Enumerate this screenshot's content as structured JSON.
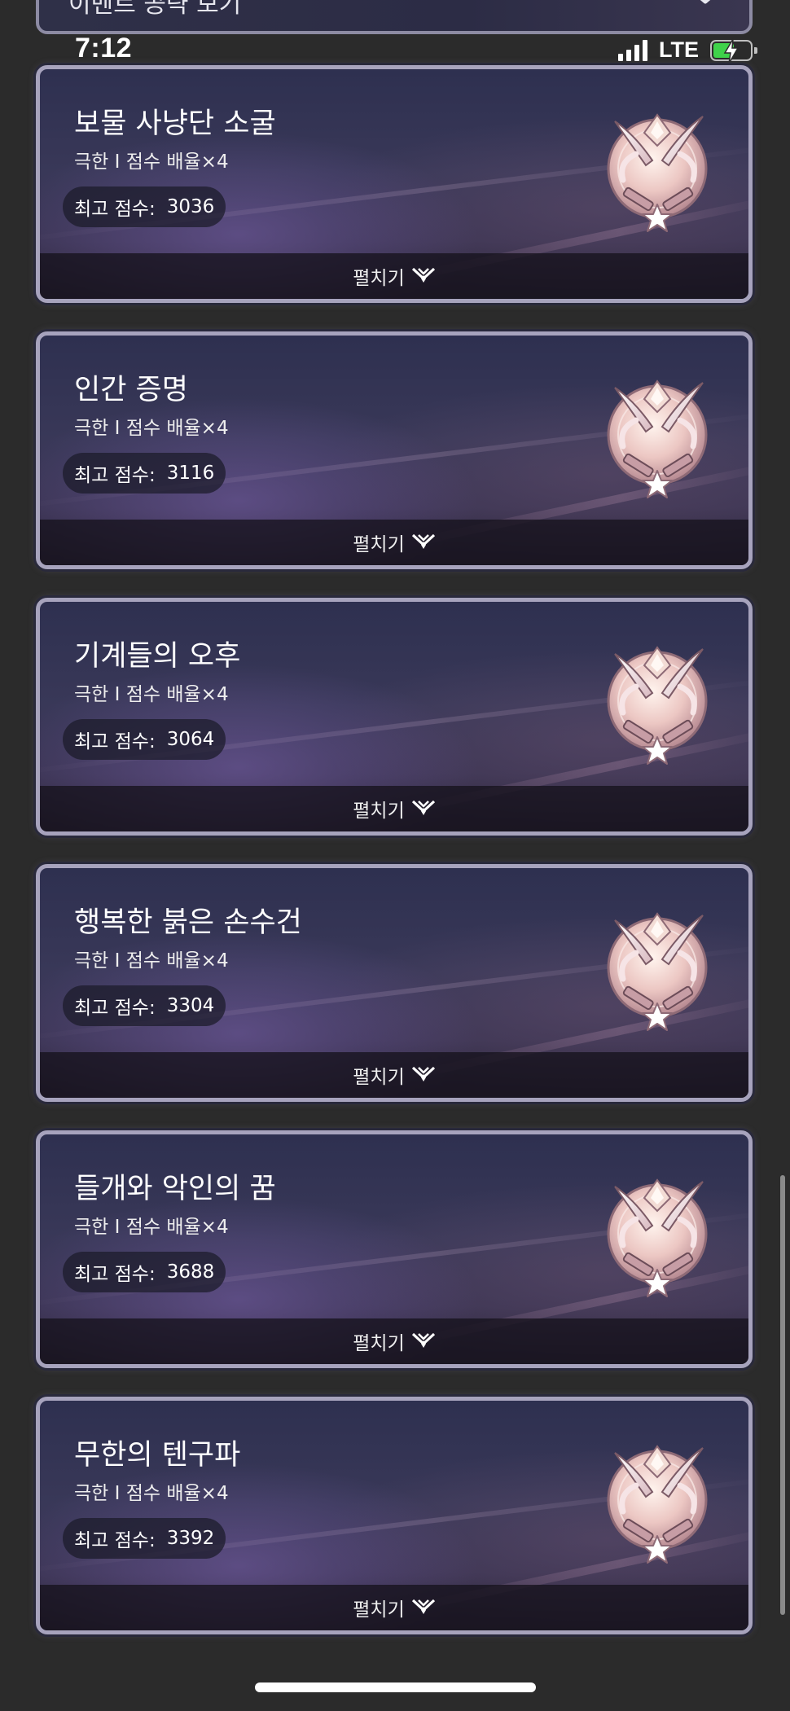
{
  "status_bar": {
    "time": "7:12",
    "network": "LTE",
    "signal_icon": "cellular-signal-icon",
    "battery_icon": "battery-charging-icon",
    "battery_level": 0.6
  },
  "header_partial": {
    "title": "이벤트 공략 보기",
    "icon": "chevron-icon"
  },
  "cards": [
    {
      "title": "보물 사냥단 소굴",
      "subtitle": "극한 I 점수 배율×4",
      "score_label": "최고 점수:",
      "score": "3036",
      "expand_label": "펼치기"
    },
    {
      "title": "인간 증명",
      "subtitle": "극한 I 점수 배율×4",
      "score_label": "최고 점수:",
      "score": "3116",
      "expand_label": "펼치기"
    },
    {
      "title": "기계들의 오후",
      "subtitle": "극한 I 점수 배율×4",
      "score_label": "최고 점수:",
      "score": "3064",
      "expand_label": "펼치기"
    },
    {
      "title": "행복한 붉은 손수건",
      "subtitle": "극한 I 점수 배율×4",
      "score_label": "최고 점수:",
      "score": "3304",
      "expand_label": "펼치기"
    },
    {
      "title": "들개와 악인의 꿈",
      "subtitle": "극한 I 점수 배율×4",
      "score_label": "최고 점수:",
      "score": "3688",
      "expand_label": "펼치기"
    },
    {
      "title": "무한의 텐구파",
      "subtitle": "극한 I 점수 배율×4",
      "score_label": "최고 점수:",
      "score": "3392",
      "expand_label": "펼치기"
    }
  ],
  "colors": {
    "background": "#2b2b2b",
    "card_border": "#a7a3bd",
    "battery_green": "#3fd24a"
  }
}
